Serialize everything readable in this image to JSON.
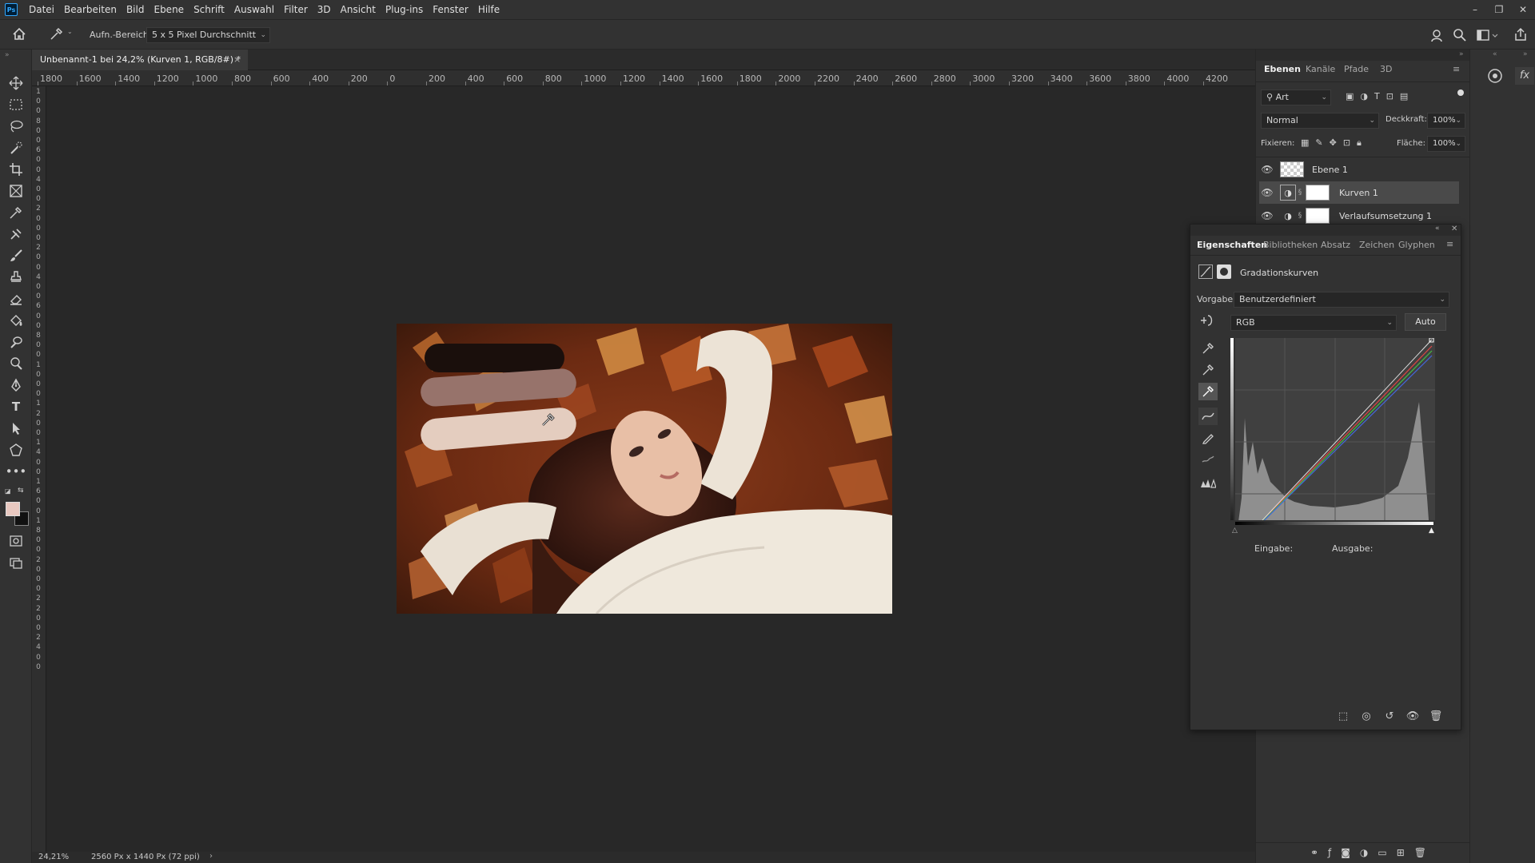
{
  "menubar": {
    "items": [
      "Datei",
      "Bearbeiten",
      "Bild",
      "Ebene",
      "Schrift",
      "Auswahl",
      "Filter",
      "3D",
      "Ansicht",
      "Plug-ins",
      "Fenster",
      "Hilfe"
    ],
    "window_controls": [
      "–",
      "❐",
      "✕"
    ]
  },
  "options": {
    "sample_label": "Aufn.-Bereich:",
    "sample_value": "5 x 5 Pixel Durchschnitt"
  },
  "document": {
    "tab_title": "Unbenannt-1 bei 24,2% (Kurven 1, RGB/8#) *",
    "zoom": "24,21%",
    "doc_info": "2560 Px x 1440 Px (72 ppi)",
    "ruler_labels": [
      "1800",
      "1600",
      "1400",
      "1200",
      "1000",
      "800",
      "600",
      "400",
      "200",
      "0",
      "200",
      "400",
      "600",
      "800",
      "1000",
      "1200",
      "1400",
      "1600",
      "1800",
      "2000",
      "2200",
      "2400",
      "2600",
      "2800",
      "3000",
      "3200",
      "3400",
      "3600",
      "3800",
      "4000",
      "4200"
    ],
    "ruler_v_labels": [
      "1",
      "0",
      "0",
      "8",
      "0",
      "0",
      "6",
      "0",
      "0",
      "4",
      "0",
      "0",
      "2",
      "0",
      "0",
      "0",
      "2",
      "0",
      "0",
      "4",
      "0",
      "0",
      "6",
      "0",
      "0",
      "8",
      "0",
      "0",
      "1",
      "0",
      "0",
      "0",
      "1",
      "2",
      "0",
      "0",
      "1",
      "4",
      "0",
      "0",
      "1",
      "6",
      "0",
      "0",
      "1",
      "8",
      "0",
      "0",
      "2",
      "0",
      "0",
      "0",
      "2",
      "2",
      "0",
      "0",
      "2",
      "4",
      "0",
      "0"
    ]
  },
  "layers_panel": {
    "tabs": [
      "Ebenen",
      "Kanäle",
      "Pfade",
      "3D"
    ],
    "filter": "Art",
    "blend_mode": "Normal",
    "opacity_label": "Deckkraft:",
    "opacity": "100%",
    "lock_label": "Fixieren:",
    "fill_label": "Fläche:",
    "fill": "100%",
    "layers": [
      {
        "name": "Ebene 1",
        "type": "pixel"
      },
      {
        "name": "Kurven 1",
        "type": "adjustment"
      },
      {
        "name": "Verlaufsumsetzung 1",
        "type": "adjustment"
      }
    ]
  },
  "properties_panel": {
    "tabs": [
      "Eigenschaften",
      "Bibliotheken",
      "Absatz",
      "Zeichen",
      "Glyphen"
    ],
    "title": "Gradationskurven",
    "preset_label": "Vorgabe:",
    "preset": "Benutzerdefiniert",
    "channel": "RGB",
    "auto_label": "Auto",
    "input_label": "Eingabe:",
    "output_label": "Ausgabe:"
  },
  "colors": {
    "foreground": "#e8c8c0",
    "background": "#111111",
    "swatch_dark": "#1a0f0c",
    "swatch_mid": "#97736b",
    "swatch_light": "#e4cdbf"
  }
}
